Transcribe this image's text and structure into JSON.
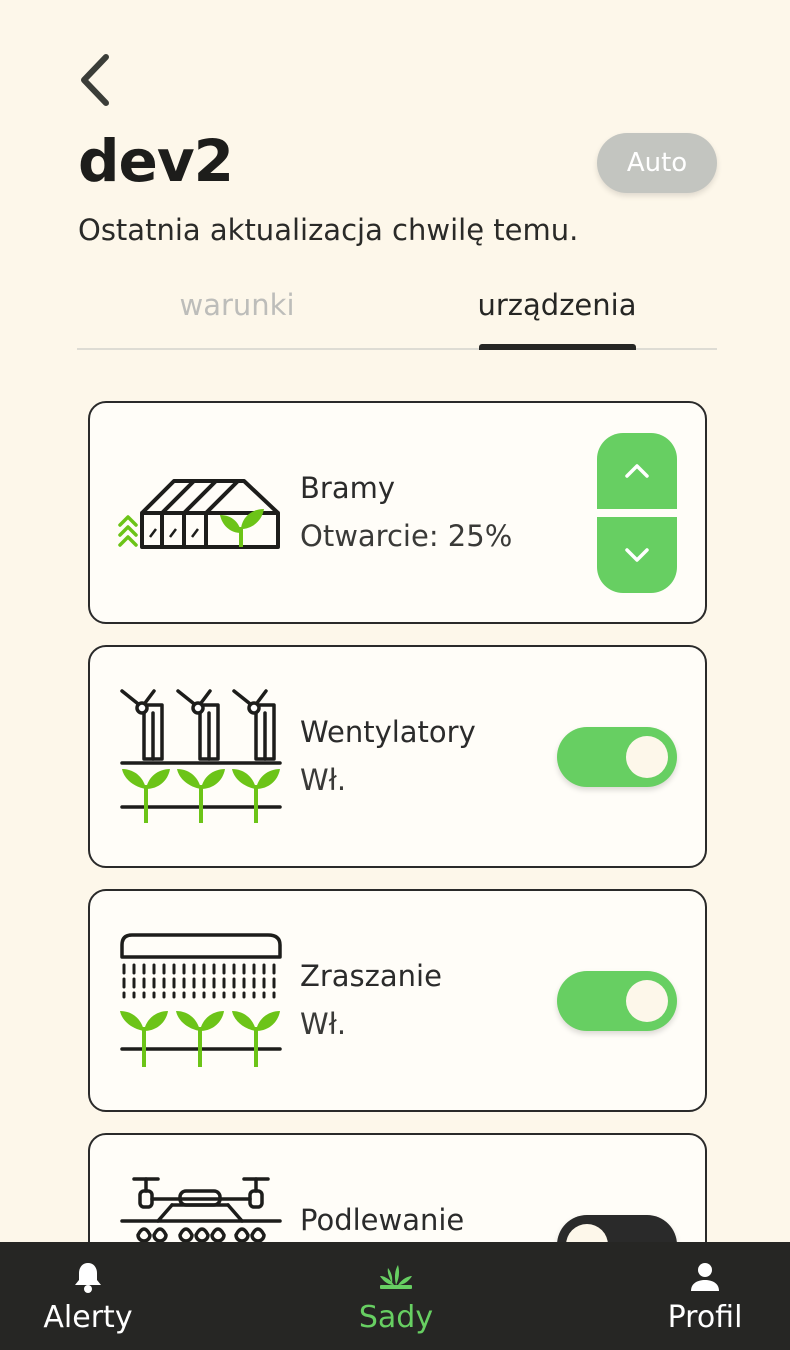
{
  "header": {
    "title": "dev2",
    "mode_label": "Auto",
    "subtitle": "Ostatnia aktualizacja chwilę temu."
  },
  "tabs": [
    {
      "label": "warunki",
      "active": false
    },
    {
      "label": "urządzenia",
      "active": true
    }
  ],
  "devices": [
    {
      "name": "Bramy",
      "status": "Otwarcie: 25%",
      "control": "stepper",
      "icon": "greenhouse-icon"
    },
    {
      "name": "Wentylatory",
      "status": "Wł.",
      "control": "toggle",
      "state": true,
      "icon": "fans-icon"
    },
    {
      "name": "Zraszanie",
      "status": "Wł.",
      "control": "toggle",
      "state": true,
      "icon": "sprinkler-icon"
    },
    {
      "name": "Podlewanie",
      "status": "",
      "control": "toggle",
      "state": false,
      "icon": "drone-icon"
    }
  ],
  "nav": {
    "alerts": "Alerty",
    "orchards": "Sady",
    "profile": "Profil"
  },
  "colors": {
    "background": "#fdf7ea",
    "accent_green": "#67cf62",
    "icon_green": "#6cc418",
    "dark": "#262624",
    "inactive_tab": "#bdbdba",
    "auto_pill": "#c3c5c0"
  }
}
